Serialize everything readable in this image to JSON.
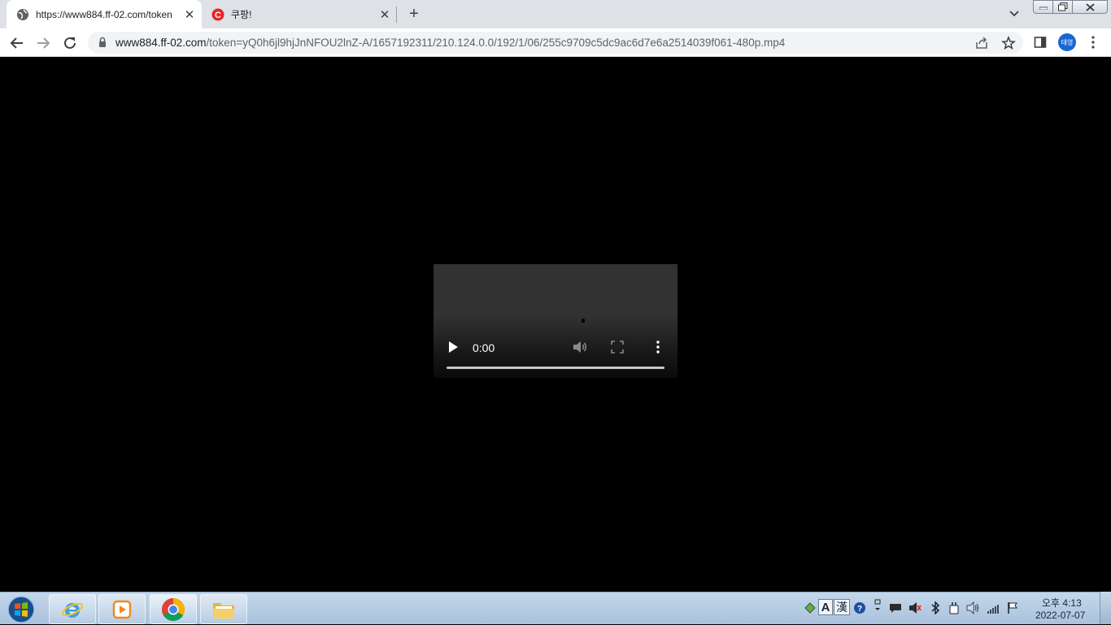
{
  "browser": {
    "tabs": [
      {
        "title": "https://www884.ff-02.com/token",
        "active": true,
        "favicon": "globe-icon"
      },
      {
        "title": "쿠팡!",
        "active": false,
        "favicon": "coupang-icon"
      }
    ],
    "new_tab_label": "+",
    "address": {
      "host": "www884.ff-02.com",
      "path": "/token=yQ0h6jl9hjJnNFOU2lnZ-A/1657192311/210.124.0.0/192/1/06/255c9709c5dc9ac6d7e6a2514039f061-480p.mp4"
    },
    "profile_label": "태영"
  },
  "video": {
    "time": "0:00",
    "progress_fraction": 0,
    "state": "paused"
  },
  "taskbar": {
    "items": [
      "start-orb",
      "internet-explorer",
      "media-player",
      "chrome",
      "file-explorer"
    ],
    "tray_ime_1": "A",
    "tray_ime_2": "漢",
    "clock_time": "오후 4:13",
    "clock_date": "2022-07-07"
  },
  "colors": {
    "tabstrip_bg": "#dee1e6",
    "taskbar_bg": "#b7cde3",
    "page_bg": "#000000",
    "accent": "#1967d2"
  }
}
